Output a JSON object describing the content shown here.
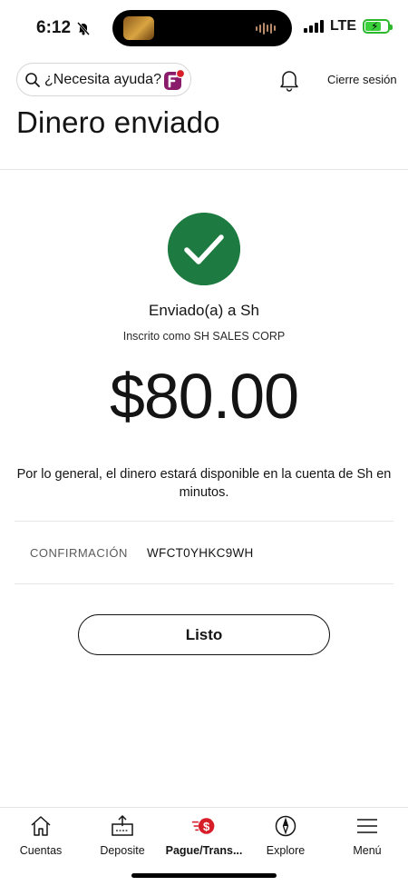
{
  "status_bar": {
    "time": "6:12",
    "network": "LTE"
  },
  "header": {
    "search_placeholder": "¿Necesita ayuda?",
    "logout_label": "Cierre sesión",
    "page_title": "Dinero enviado"
  },
  "confirmation": {
    "sent_to": "Enviado(a) a Sh",
    "enrolled_as": "Inscrito como SH SALES CORP",
    "amount": "$80.00",
    "availability_note": "Por lo general, el dinero estará disponible en la cuenta de Sh en minutos.",
    "confirmation_label": "CONFIRMACIÓN",
    "confirmation_code": "WFCT0YHKC9WH",
    "done_label": "Listo",
    "success_color": "#1d7a41"
  },
  "bottom_nav": {
    "items": [
      {
        "label": "Cuentas",
        "icon": "home-icon"
      },
      {
        "label": "Deposite",
        "icon": "deposit-icon"
      },
      {
        "label": "Pague/Trans...",
        "icon": "pay-transfer-icon",
        "active": true
      },
      {
        "label": "Explore",
        "icon": "compass-icon"
      },
      {
        "label": "Menú",
        "icon": "menu-icon"
      }
    ],
    "accent_color": "#d71e28"
  }
}
